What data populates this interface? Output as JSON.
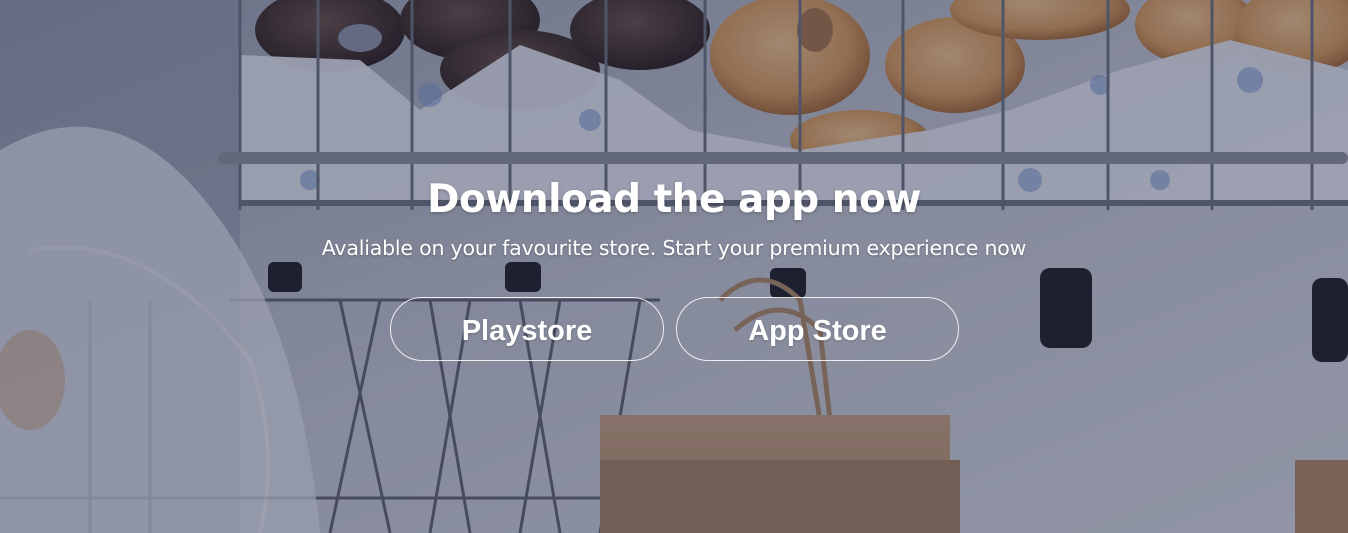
{
  "hero": {
    "background": {
      "description_icon": "bagel-shop-photo",
      "overlay_color": "#1c2444"
    },
    "title": "Download the app now",
    "subtitle": "Avaliable on your favourite store. Start your premium experience now",
    "buttons": [
      {
        "label": "Playstore"
      },
      {
        "label": "App Store"
      }
    ]
  }
}
